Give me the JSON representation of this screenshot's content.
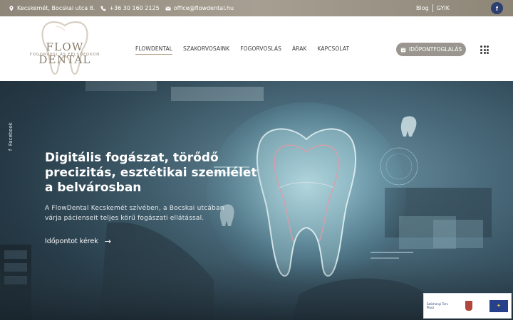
{
  "topbar": {
    "address": "Kecskemét, Bocskai utca 8.",
    "phone": "+36 30 160 2125",
    "email": "office@flowdental.hu",
    "links": [
      "Blog",
      "GYIK"
    ]
  },
  "brand": {
    "name": "FLOW DENTAL",
    "tagline": "FOGORVOSI ÁS FELSŐFOKON",
    "accent_color": "#8a7f6f"
  },
  "nav": {
    "items": [
      "FLOWDENTAL",
      "SZAKORVOSAINK",
      "FOGORVOSLÁS",
      "ÁRAK",
      "KAPCSOLAT"
    ],
    "active_index": 0
  },
  "booking": {
    "label": "IDŐPONTFOGLALÁS"
  },
  "hero": {
    "side_label": "Facebook",
    "title_lines": [
      "Digitális fogászat, törődő",
      "precizitás, esztétikai szemlélet",
      "a belvárosban"
    ],
    "text_lines": [
      "A FlowDental Kecskemét szívében, a Bocskai utcában",
      "várja pácienseit teljes körű fogászati ellátással."
    ],
    "cta_label": "Időpontot kérek"
  },
  "footer_badge": {
    "line1": "Széchenyi Terv",
    "line2": "Plusz"
  }
}
